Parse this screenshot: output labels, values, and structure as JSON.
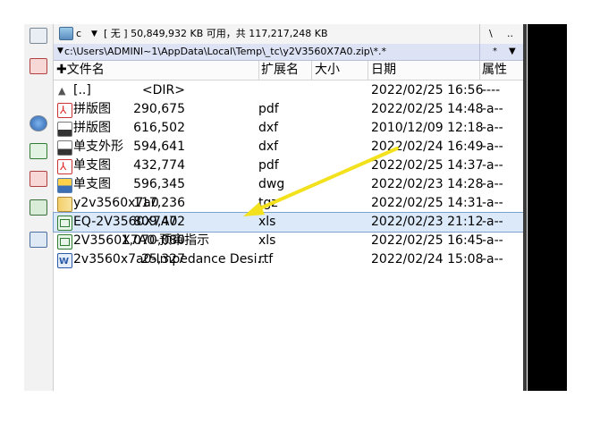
{
  "drive": {
    "letter": "c",
    "info": "[ 无 ]  50,849,932 KB 可用，共 117,217,248 KB",
    "btn_root": "\\",
    "btn_up": ".."
  },
  "path": {
    "text": "c:\\Users\\ADMINI~1\\AppData\\Local\\Temp\\_tc\\y2V3560X7A0.zip\\*.*",
    "filter": "*"
  },
  "columns": {
    "name": "✚文件名",
    "ext": "扩展名",
    "size": "大小",
    "date": "日期",
    "attr": "属性"
  },
  "files": [
    {
      "icon": "parent-dir-icon",
      "name": "[..]",
      "ext": "",
      "size": "<DIR>",
      "date": "2022/02/25 16:56",
      "attr": "----"
    },
    {
      "icon": "pdf-file-icon",
      "name": "拼版图",
      "ext": "pdf",
      "size": "290,675",
      "date": "2022/02/25 14:48",
      "attr": "-a--"
    },
    {
      "icon": "dxf-file-icon",
      "name": "拼版图",
      "ext": "dxf",
      "size": "616,502",
      "date": "2010/12/09 12:18",
      "attr": "-a--"
    },
    {
      "icon": "dxf-file-icon",
      "name": "单支外形",
      "ext": "dxf",
      "size": "594,641",
      "date": "2022/02/24 16:49",
      "attr": "-a--"
    },
    {
      "icon": "pdf-file-icon",
      "name": "单支图",
      "ext": "pdf",
      "size": "432,774",
      "date": "2022/02/25 14:37",
      "attr": "-a--"
    },
    {
      "icon": "dwg-file-icon",
      "name": "单支图",
      "ext": "dwg",
      "size": "596,345",
      "date": "2022/02/23 14:28",
      "attr": "-a--"
    },
    {
      "icon": "tgz-archive-icon",
      "name": "y2v3560x7a0",
      "ext": "tgz",
      "size": "117,236",
      "date": "2022/02/25 14:31",
      "attr": "-a--"
    },
    {
      "icon": "xls-file-icon",
      "name": "EQ-2V3560X7A0",
      "ext": "xls",
      "size": "809,472",
      "date": "2022/02/23 21:12",
      "attr": "-a--"
    },
    {
      "icon": "xls-file-icon",
      "name": "2V3560X7A0-预审指示",
      "ext": "xls",
      "size": "1,070,080",
      "date": "2022/02/25 16:45",
      "attr": "-a--"
    },
    {
      "icon": "rtf-file-icon",
      "name": "2v3560x7a0-Impedance Desi..",
      "ext": "rtf",
      "size": "25,327",
      "date": "2022/02/24 15:08",
      "attr": "-a--"
    }
  ],
  "selected_row_index": 7,
  "colors": {
    "selection_bg": "#dbe9f9",
    "selection_border": "#7da2ce",
    "path_bar_bg": "#dde3f4",
    "annotation_arrow": "#f2e11c"
  }
}
